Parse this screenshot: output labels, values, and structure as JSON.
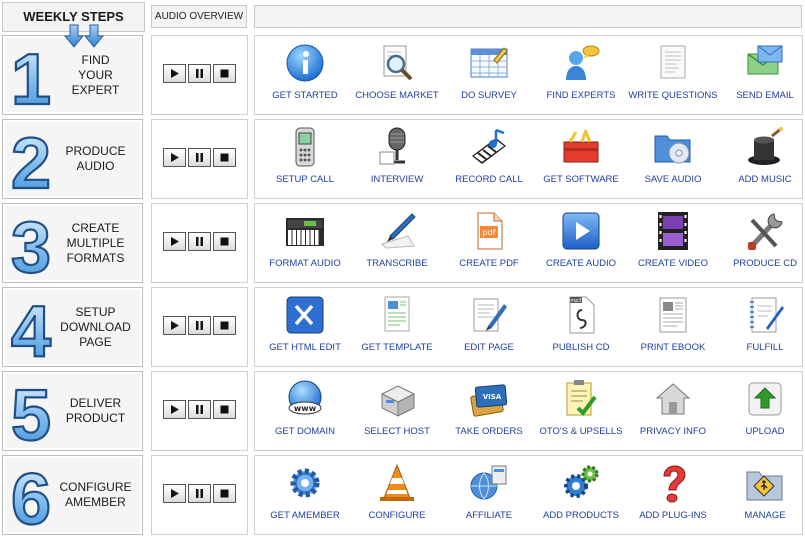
{
  "header": {
    "weekly_steps": "WEEKLY STEPS",
    "audio_overview": "AUDIO OVERVIEW"
  },
  "colors": {
    "digit": "#3f8fd8",
    "label": "#1e3f9e",
    "panel": "#f5f5f5"
  },
  "controls": {
    "play_icon": "play-icon",
    "pause_icon": "pause-icon",
    "stop_icon": "stop-icon"
  },
  "steps": [
    {
      "number": "1",
      "title": "FIND\nYOUR\nEXPERT",
      "items": [
        {
          "label": "GET STARTED",
          "icon": "info"
        },
        {
          "label": "CHOOSE MARKET",
          "icon": "magnifier-doc"
        },
        {
          "label": "DO SURVEY",
          "icon": "spreadsheet"
        },
        {
          "label": "FIND EXPERTS",
          "icon": "user-chat"
        },
        {
          "label": "WRITE QUESTIONS",
          "icon": "note-doc"
        },
        {
          "label": "SEND EMAIL",
          "icon": "envelope"
        }
      ]
    },
    {
      "number": "2",
      "title": "PRODUCE\nAUDIO",
      "items": [
        {
          "label": "SETUP CALL",
          "icon": "mobile-phone"
        },
        {
          "label": "INTERVIEW",
          "icon": "microphone"
        },
        {
          "label": "RECORD CALL",
          "icon": "music-keyboard"
        },
        {
          "label": "GET SOFTWARE",
          "icon": "toolbox"
        },
        {
          "label": "SAVE AUDIO",
          "icon": "folder-cd"
        },
        {
          "label": "ADD MUSIC",
          "icon": "magic-hat"
        }
      ]
    },
    {
      "number": "3",
      "title": "CREATE\nMULTIPLE\nFORMATS",
      "items": [
        {
          "label": "FORMAT AUDIO",
          "icon": "synthesizer"
        },
        {
          "label": "TRANSCRIBE",
          "icon": "pen-paper"
        },
        {
          "label": "CREATE PDF",
          "icon": "pdf-file"
        },
        {
          "label": "CREATE AUDIO",
          "icon": "play-button"
        },
        {
          "label": "CREATE VIDEO",
          "icon": "film-strip"
        },
        {
          "label": "PRODUCE CD",
          "icon": "tools"
        }
      ]
    },
    {
      "number": "4",
      "title": "SETUP\nDOWNLOAD\nPAGE",
      "items": [
        {
          "label": "GET HTML EDIT",
          "icon": "blue-tools"
        },
        {
          "label": "GET TEMPLATE",
          "icon": "doc-template"
        },
        {
          "label": "EDIT PAGE",
          "icon": "edit-doc"
        },
        {
          "label": "PUBLISH CD",
          "icon": "mp3-file"
        },
        {
          "label": "PRINT EBOOK",
          "icon": "newspaper"
        },
        {
          "label": "FULFILL",
          "icon": "notebook-pen"
        }
      ]
    },
    {
      "number": "5",
      "title": "DELIVER\nPRODUCT",
      "items": [
        {
          "label": "GET DOMAIN",
          "icon": "globe-www"
        },
        {
          "label": "SELECT HOST",
          "icon": "server"
        },
        {
          "label": "TAKE ORDERS",
          "icon": "credit-cards"
        },
        {
          "label": "OTO'S & UPSELLS",
          "icon": "checklist"
        },
        {
          "label": "PRIVACY INFO",
          "icon": "house"
        },
        {
          "label": "UPLOAD",
          "icon": "upload-arrow"
        }
      ]
    },
    {
      "number": "6",
      "title": "CONFIGURE\nAMEMBER",
      "items": [
        {
          "label": "GET AMEMBER",
          "icon": "gears"
        },
        {
          "label": "CONFIGURE",
          "icon": "traffic-cone"
        },
        {
          "label": "AFFILIATE",
          "icon": "network-globe"
        },
        {
          "label": "ADD PRODUCTS",
          "icon": "colored-gears"
        },
        {
          "label": "ADD PLUG-INS",
          "icon": "question-mark"
        },
        {
          "label": "MANAGE",
          "icon": "folder-sign"
        }
      ]
    }
  ]
}
